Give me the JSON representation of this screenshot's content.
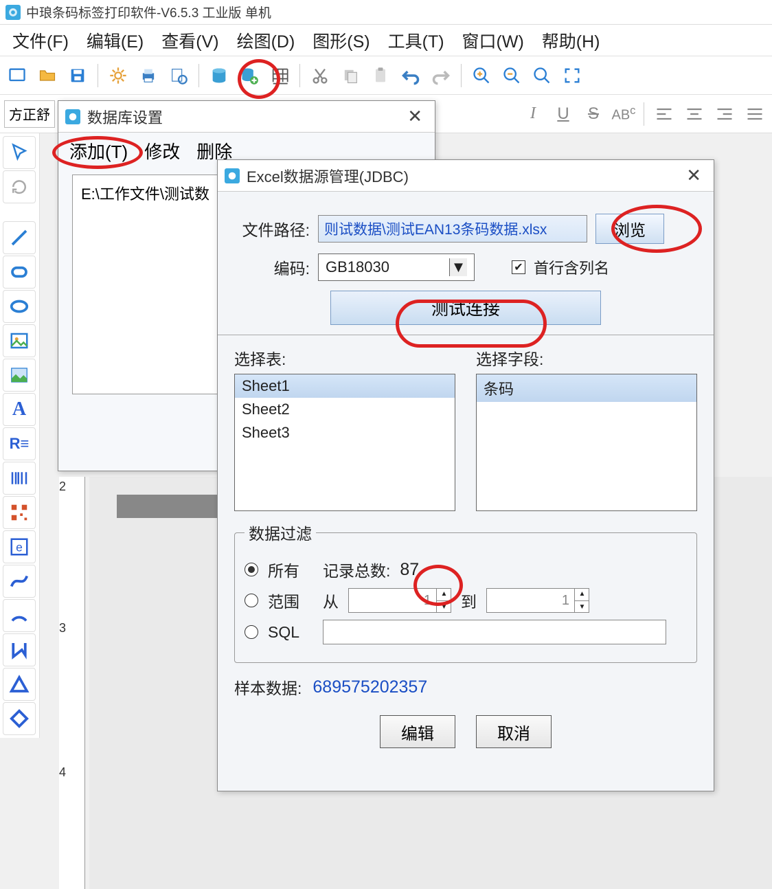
{
  "app": {
    "title": "中琅条码标签打印软件-V6.5.3 工业版 单机"
  },
  "menu": {
    "file": "文件(F)",
    "edit": "编辑(E)",
    "view": "查看(V)",
    "draw": "绘图(D)",
    "shape": "图形(S)",
    "tool": "工具(T)",
    "window": "窗口(W)",
    "help": "帮助(H)"
  },
  "toolbar2": {
    "font_partial": "方正舒"
  },
  "dlg_db": {
    "title": "数据库设置",
    "add": "添加(T)",
    "modify": "修改",
    "delete": "删除",
    "path": "E:\\工作文件\\测试数"
  },
  "dlg_excel": {
    "title": "Excel数据源管理(JDBC)",
    "path_label": "文件路径:",
    "path_value": "则试数据\\测试EAN13条码数据.xlsx",
    "browse": "浏览",
    "encoding_label": "编码:",
    "encoding_value": "GB18030",
    "first_row_label": "首行含列名",
    "first_row_checked": true,
    "test_conn": "测试连接",
    "select_table": "选择表:",
    "select_field": "选择字段:",
    "sheets": [
      "Sheet1",
      "Sheet2",
      "Sheet3"
    ],
    "sheet_selected": 0,
    "field": "条码",
    "filter_legend": "数据过滤",
    "radio_all": "所有",
    "record_count_label": "记录总数:",
    "record_count": "87",
    "radio_range": "范围",
    "from_label": "从",
    "to_label": "到",
    "from_val": "1",
    "to_val": "1",
    "radio_sql": "SQL",
    "sample_label": "样本数据:",
    "sample_value": "689575202357",
    "edit_btn": "编辑",
    "cancel_btn": "取消"
  },
  "ruler": {
    "t2": "2",
    "t3": "3",
    "t4": "4"
  }
}
